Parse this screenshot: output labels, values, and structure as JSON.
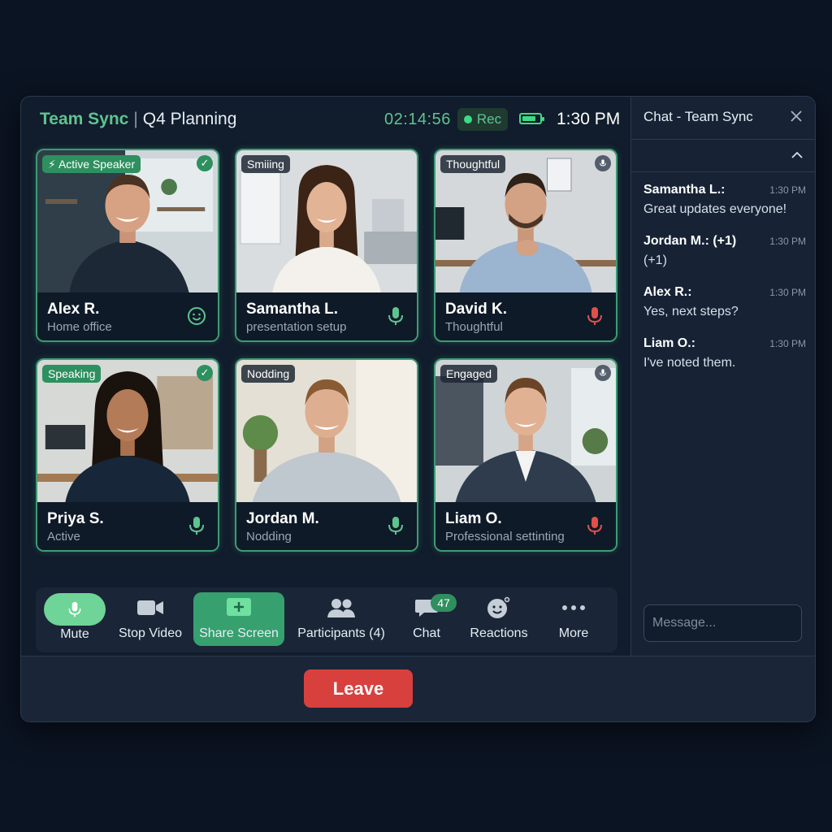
{
  "header": {
    "app_name": "Team Sync",
    "separator": "|",
    "meeting_name": "Q4 Planning",
    "elapsed": "02:14:56",
    "rec_label": "Rec",
    "battery_level": 0.8,
    "clock": "1:30 PM"
  },
  "participants": [
    {
      "name": "Alex R.",
      "subtitle": "Home office",
      "badge": "Active Speaker",
      "badge_style": "green",
      "corner": "check",
      "status_icon": "smile-icon"
    },
    {
      "name": "Samantha L.",
      "subtitle": "presentation setup",
      "badge": "Smiiing",
      "badge_style": "dark",
      "corner": "",
      "status_icon": "mic-on-icon"
    },
    {
      "name": "David K.",
      "subtitle": "Thoughtful",
      "badge": "Thoughtful",
      "badge_style": "dark",
      "corner": "mic",
      "status_icon": "mic-muted-icon"
    },
    {
      "name": "Priya S.",
      "subtitle": "Active",
      "badge": "Speaking",
      "badge_style": "green",
      "corner": "check",
      "status_icon": "mic-on-icon"
    },
    {
      "name": "Jordan M.",
      "subtitle": "Nodding",
      "badge": "Nodding",
      "badge_style": "dark",
      "corner": "",
      "status_icon": "mic-on-icon"
    },
    {
      "name": "Liam O.",
      "subtitle": "Professional settinting",
      "badge": "Engaged",
      "badge_style": "dark",
      "corner": "mic",
      "status_icon": "mic-muted-icon"
    }
  ],
  "controls": {
    "mute": "Mute",
    "stop_video": "Stop Video",
    "share_screen": "Share Screen",
    "participants": "Participants (4)",
    "chat": "Chat",
    "chat_badge": "47",
    "reactions": "Reactions",
    "more": "More"
  },
  "leave_label": "Leave",
  "chat_panel": {
    "title": "Chat - Team Sync",
    "messages": [
      {
        "sender": "Samantha L.:",
        "time": "1:30 PM",
        "text": "Great updates everyone!"
      },
      {
        "sender": "Jordan M.: (+1)",
        "time": "1:30 PM",
        "text": "(+1)"
      },
      {
        "sender": "Alex R.:",
        "time": "1:30 PM",
        "text": "Yes, next steps?"
      },
      {
        "sender": "Liam O.:",
        "time": "1:30 PM",
        "text": "I've noted them."
      }
    ],
    "input_placeholder": "Message..."
  },
  "colors": {
    "accent": "#5ec48f",
    "tile_border": "#3d9c74",
    "leave": "#d8403d",
    "muted_mic": "#e0504b",
    "background": "#0b1422"
  }
}
